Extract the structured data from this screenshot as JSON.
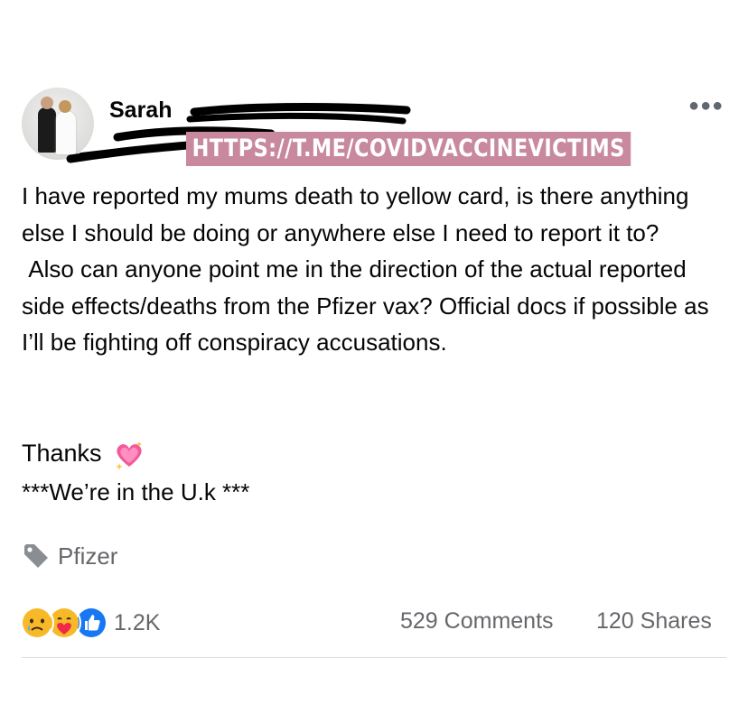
{
  "post": {
    "author_name": "Sarah",
    "watermark_url": "HTTPS://T.ME/COVIDVACCINEVICTIMS",
    "more_icon": "more-horizontal-icon",
    "paragraphs": [
      "I have reported my mums death to yellow card, is there anything else I should be doing or anywhere else I need to report it to?",
      " Also can anyone point me in the direction of the actual reported side effects/deaths from the Pfizer vax? Official docs if possible as I’ll be fighting off conspiracy accusations."
    ],
    "thanks": "Thanks",
    "thanks_emoji": "sparkling-heart-icon",
    "location_note": "***We’re in the U.k ***"
  },
  "tag": {
    "icon": "tag-icon",
    "label": "Pfizer"
  },
  "footer": {
    "reaction_icons": [
      "sad-reaction-icon",
      "care-reaction-icon",
      "like-reaction-icon"
    ],
    "reaction_count": "1.2K",
    "comments": "529 Comments",
    "shares": "120 Shares"
  },
  "colors": {
    "watermark_bg": "#c8889e",
    "secondary_text": "#65676b",
    "like_blue": "#1877f2",
    "reaction_yellow": "#f7b928"
  }
}
